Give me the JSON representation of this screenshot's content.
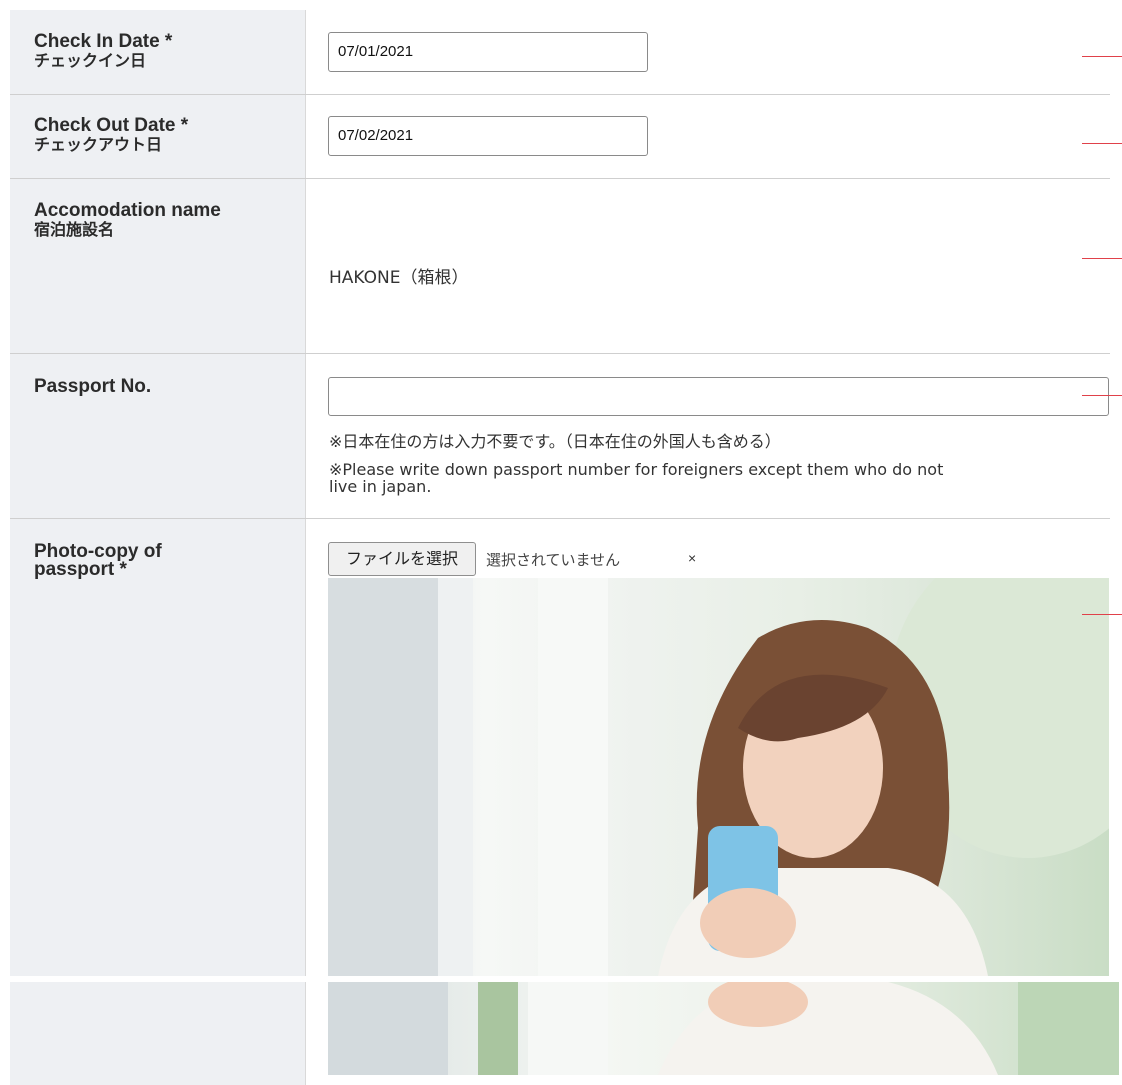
{
  "form": {
    "check_in": {
      "label_en": "Check In Date *",
      "label_jp": "チェックイン日",
      "value": "07/01/2021"
    },
    "check_out": {
      "label_en": "Check Out Date *",
      "label_jp": "チェックアウト日",
      "value": "07/02/2021"
    },
    "accommodation": {
      "label_en": "Accomodation name",
      "label_jp": "宿泊施設名",
      "value": "HAKONE（箱根）"
    },
    "passport": {
      "label_en": "Passport No.",
      "value": "",
      "note_jp": "※日本在住の方は入力不要です。（日本在住の外国人も含める）",
      "note_en_1": "※Please write down passport number for foreigners except them who do not",
      "note_en_2": "live in japan."
    },
    "photo_copy": {
      "label_en_1": "Photo-copy of",
      "label_en_2": "passport *",
      "choose_button": "ファイルを選択",
      "no_file_text": "選択されていません",
      "clear_label": "×"
    }
  },
  "colors": {
    "label_bg": "#eef0f3",
    "marker": "#e0414a",
    "border": "#cfcfcf"
  }
}
